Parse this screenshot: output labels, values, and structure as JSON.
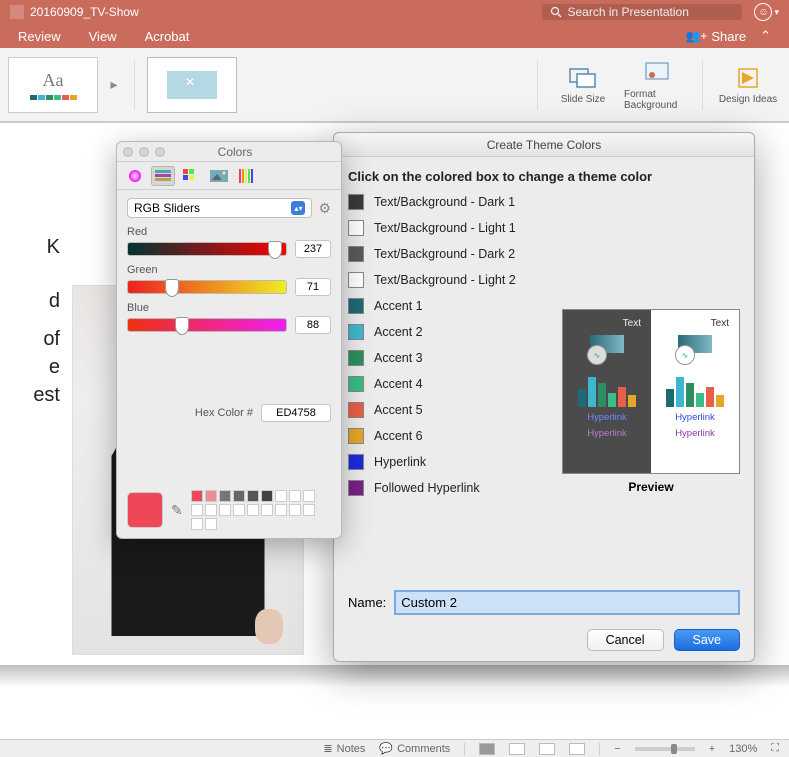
{
  "titlebar": {
    "document_name": "20160909_TV-Show",
    "search_placeholder": "Search in Presentation"
  },
  "menubar": {
    "items": [
      "Review",
      "View",
      "Acrobat"
    ],
    "share_label": "Share"
  },
  "ribbon": {
    "slide_size": "Slide Size",
    "format_bg": "Format Background",
    "design_ideas": "Design Ideas"
  },
  "slide_text": {
    "l1": "K",
    "l2": "d",
    "l3": "of",
    "l4": "e",
    "l5": "est"
  },
  "theme_dialog": {
    "title": "Create Theme Colors",
    "instruction": "Click on the colored box to change a theme color",
    "items": [
      {
        "label": "Text/Background - Dark 1",
        "color": "#3a3a3a"
      },
      {
        "label": "Text/Background - Light 1",
        "color": "#ffffff"
      },
      {
        "label": "Text/Background - Dark 2",
        "color": "#5a5a5a"
      },
      {
        "label": "Text/Background - Light 2",
        "color": "#ffffff"
      },
      {
        "label": "Accent 1",
        "color": "#1d6a77"
      },
      {
        "label": "Accent 2",
        "color": "#3fb6cf"
      },
      {
        "label": "Accent 3",
        "color": "#2c8f61"
      },
      {
        "label": "Accent 4",
        "color": "#3bbd87"
      },
      {
        "label": "Accent 5",
        "color": "#e85e48"
      },
      {
        "label": "Accent 6",
        "color": "#e6a628"
      },
      {
        "label": "Hyperlink",
        "color": "#1b2be0"
      },
      {
        "label": "Followed Hyperlink",
        "color": "#7a1f86"
      }
    ],
    "preview": {
      "text_label": "Text",
      "hyperlink": "Hyperlink",
      "caption": "Preview"
    },
    "name_label": "Name:",
    "name_value": "Custom 2",
    "cancel": "Cancel",
    "save": "Save"
  },
  "colors_panel": {
    "title": "Colors",
    "mode": "RGB Sliders",
    "sliders": {
      "red": {
        "label": "Red",
        "value": 237
      },
      "green": {
        "label": "Green",
        "value": 71
      },
      "blue": {
        "label": "Blue",
        "value": 88
      }
    },
    "hex_label": "Hex Color #",
    "hex_value": "ED4758",
    "current_color": "#ed4758",
    "recent": [
      "#ed4758",
      "#f08a93",
      "#777777",
      "#666666",
      "#555555",
      "#444444"
    ]
  },
  "statusbar": {
    "notes": "Notes",
    "comments": "Comments",
    "zoom": "130%"
  }
}
